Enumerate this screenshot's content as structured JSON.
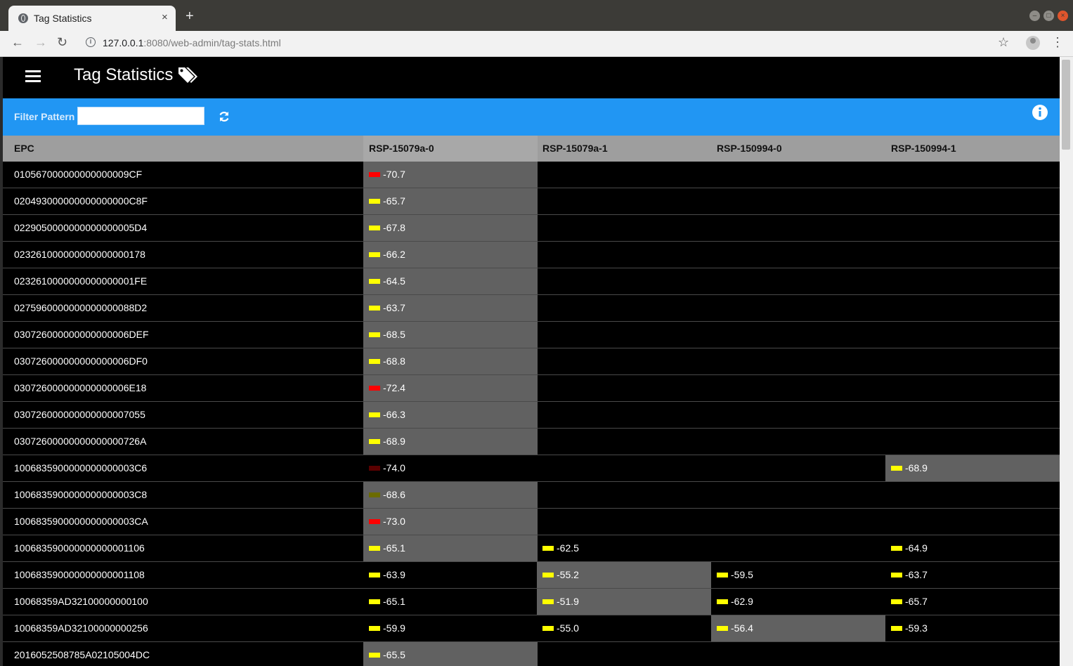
{
  "browser": {
    "tab_title": "Tag Statistics",
    "tab_close": "×",
    "new_tab": "+",
    "url_host": "127.0.0.1",
    "url_path": ":8080/web-admin/tag-stats.html"
  },
  "app": {
    "title": "Tag Statistics",
    "filter_label": "Filter Pattern",
    "filter_value": ""
  },
  "colors": {
    "accent": "#2196f3",
    "weak_red": "#ff0000",
    "ok_yellow": "#ffff00",
    "dark_red": "#5a0000",
    "olive": "#6b6b00",
    "highlight_cell": "#616161"
  },
  "table": {
    "headers": [
      "EPC",
      "RSP-15079a-0",
      "RSP-15079a-1",
      "RSP-150994-0",
      "RSP-150994-1"
    ],
    "rows": [
      {
        "epc": "010567000000000000009CF",
        "cells": [
          {
            "v": "-70.7",
            "c": "#ff0000",
            "hl": true
          },
          null,
          null,
          null
        ]
      },
      {
        "epc": "020493000000000000000C8F",
        "cells": [
          {
            "v": "-65.7",
            "c": "#ffff00",
            "hl": true
          },
          null,
          null,
          null
        ]
      },
      {
        "epc": "0229050000000000000005D4",
        "cells": [
          {
            "v": "-67.8",
            "c": "#ffff00",
            "hl": true
          },
          null,
          null,
          null
        ]
      },
      {
        "epc": "023261000000000000000178",
        "cells": [
          {
            "v": "-66.2",
            "c": "#ffff00",
            "hl": true
          },
          null,
          null,
          null
        ]
      },
      {
        "epc": "0232610000000000000001FE",
        "cells": [
          {
            "v": "-64.5",
            "c": "#ffff00",
            "hl": true
          },
          null,
          null,
          null
        ]
      },
      {
        "epc": "0275960000000000000088D2",
        "cells": [
          {
            "v": "-63.7",
            "c": "#ffff00",
            "hl": true
          },
          null,
          null,
          null
        ]
      },
      {
        "epc": "030726000000000000006DEF",
        "cells": [
          {
            "v": "-68.5",
            "c": "#ffff00",
            "hl": true
          },
          null,
          null,
          null
        ]
      },
      {
        "epc": "030726000000000000006DF0",
        "cells": [
          {
            "v": "-68.8",
            "c": "#ffff00",
            "hl": true
          },
          null,
          null,
          null
        ]
      },
      {
        "epc": "030726000000000000006E18",
        "cells": [
          {
            "v": "-72.4",
            "c": "#ff0000",
            "hl": true
          },
          null,
          null,
          null
        ]
      },
      {
        "epc": "030726000000000000007055",
        "cells": [
          {
            "v": "-66.3",
            "c": "#ffff00",
            "hl": true
          },
          null,
          null,
          null
        ]
      },
      {
        "epc": "03072600000000000000726A",
        "cells": [
          {
            "v": "-68.9",
            "c": "#ffff00",
            "hl": true
          },
          null,
          null,
          null
        ]
      },
      {
        "epc": "1006835900000000000003C6",
        "cells": [
          {
            "v": "-74.0",
            "c": "#5a0000",
            "hl": false
          },
          null,
          null,
          {
            "v": "-68.9",
            "c": "#ffff00",
            "hl": true
          }
        ]
      },
      {
        "epc": "1006835900000000000003C8",
        "cells": [
          {
            "v": "-68.6",
            "c": "#6b6b00",
            "hl": true
          },
          null,
          null,
          null
        ]
      },
      {
        "epc": "1006835900000000000003CA",
        "cells": [
          {
            "v": "-73.0",
            "c": "#ff0000",
            "hl": true
          },
          null,
          null,
          null
        ]
      },
      {
        "epc": "100683590000000000001106",
        "cells": [
          {
            "v": "-65.1",
            "c": "#ffff00",
            "hl": true
          },
          {
            "v": "-62.5",
            "c": "#ffff00",
            "hl": false
          },
          null,
          {
            "v": "-64.9",
            "c": "#ffff00",
            "hl": false
          }
        ]
      },
      {
        "epc": "100683590000000000001108",
        "cells": [
          {
            "v": "-63.9",
            "c": "#ffff00",
            "hl": false
          },
          {
            "v": "-55.2",
            "c": "#ffff00",
            "hl": true
          },
          {
            "v": "-59.5",
            "c": "#ffff00",
            "hl": false
          },
          {
            "v": "-63.7",
            "c": "#ffff00",
            "hl": false
          }
        ]
      },
      {
        "epc": "10068359AD32100000000100",
        "cells": [
          {
            "v": "-65.1",
            "c": "#ffff00",
            "hl": false
          },
          {
            "v": "-51.9",
            "c": "#ffff00",
            "hl": true
          },
          {
            "v": "-62.9",
            "c": "#ffff00",
            "hl": false
          },
          {
            "v": "-65.7",
            "c": "#ffff00",
            "hl": false
          }
        ]
      },
      {
        "epc": "10068359AD32100000000256",
        "cells": [
          {
            "v": "-59.9",
            "c": "#ffff00",
            "hl": false
          },
          {
            "v": "-55.0",
            "c": "#ffff00",
            "hl": false
          },
          {
            "v": "-56.4",
            "c": "#ffff00",
            "hl": true
          },
          {
            "v": "-59.3",
            "c": "#ffff00",
            "hl": false
          }
        ]
      },
      {
        "epc": "2016052508785A02105004DC",
        "cells": [
          {
            "v": "-65.5",
            "c": "#ffff00",
            "hl": true
          },
          null,
          null,
          null
        ]
      }
    ]
  }
}
